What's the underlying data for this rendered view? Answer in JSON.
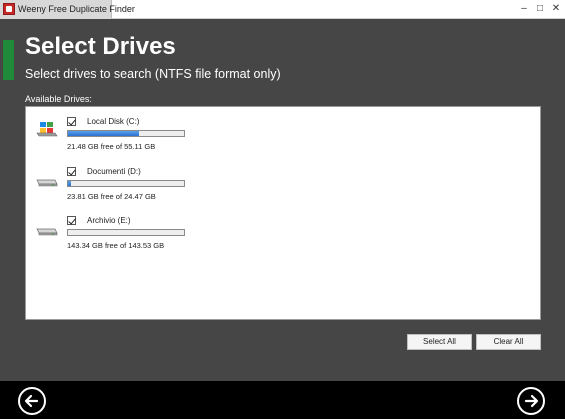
{
  "window": {
    "title": "Weeny Free Duplicate Finder",
    "controls": {
      "minimize": "–",
      "maximize": "□",
      "close": "✕"
    }
  },
  "header": {
    "title": "Select Drives",
    "subtitle": "Select drives to search (NTFS file format only)"
  },
  "drives_label": "Available Drives:",
  "drives": [
    {
      "name": "Local Disk (C:)",
      "checked": true,
      "used_fraction": 0.61,
      "free_text": "21.48 GB free of 55.11 GB",
      "icon": "system-drive-icon"
    },
    {
      "name": "Documenti (D:)",
      "checked": true,
      "used_fraction": 0.03,
      "free_text": "23.81 GB free of 24.47 GB",
      "icon": "hard-drive-icon"
    },
    {
      "name": "Archivio (E:)",
      "checked": true,
      "used_fraction": 0.0,
      "free_text": "143.34 GB free of 143.53 GB",
      "icon": "hard-drive-icon"
    }
  ],
  "buttons": {
    "select_all": "Select All",
    "clear_all": "Clear All"
  },
  "nav": {
    "back_icon": "arrow-left-circle-icon",
    "next_icon": "arrow-right-circle-icon"
  },
  "colors": {
    "background": "#464646",
    "accent": "#1f8a3a",
    "progress": "#2a72cf",
    "footer": "#000000"
  }
}
